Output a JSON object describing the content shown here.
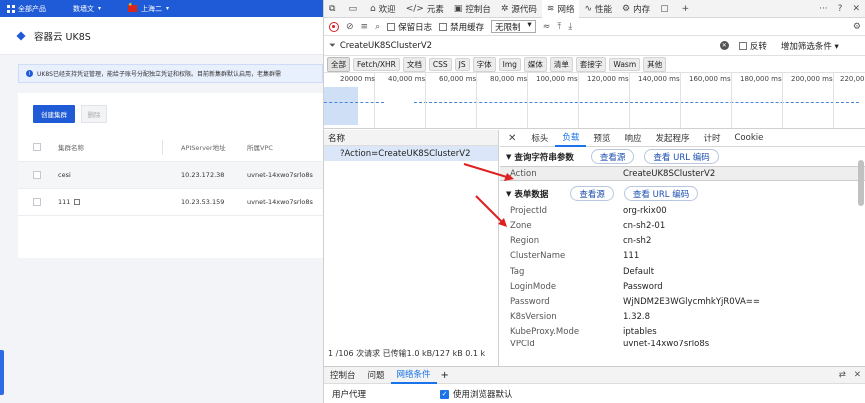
{
  "console": {
    "topnav": {
      "all_products": "全部产品",
      "project": "数墙文",
      "region": "上海二"
    },
    "page_title": "容器云 UK8S",
    "notice": "UK8S已经支持凭证管理，能给子账号分配独立凭证和权限。目前新集群默认启用，老集群需",
    "create_button": "创建集群",
    "delete_button": "删除",
    "table": {
      "headers": [
        "集群名称",
        "APIServer地址",
        "所属VPC"
      ],
      "rows": [
        {
          "name": "cesi",
          "api": "10.23.172.38",
          "vpc": "uvnet-14xwo7srlo8s"
        },
        {
          "name": "111",
          "api": "10.23.53.159",
          "vpc": "uvnet-14xwo7srlo8s"
        }
      ]
    }
  },
  "devtools": {
    "tabs": [
      "欢迎",
      "元素",
      "控制台",
      "源代码",
      "网络",
      "性能",
      "内存"
    ],
    "active_tab": "网络",
    "toolbar": {
      "preserve_log": "保留日志",
      "disable_cache": "禁用缓存",
      "throttle": "无限制"
    },
    "filter": {
      "value": "CreateUK8SClusterV2",
      "invert": "反转",
      "more_filters": "增加筛选条件"
    },
    "type_filters": [
      "全部",
      "Fetch/XHR",
      "文档",
      "CSS",
      "JS",
      "字体",
      "Img",
      "媒体",
      "清单",
      "套接字",
      "Wasm",
      "其他"
    ],
    "timeline_ticks": [
      "20000 ms",
      "40,000 ms",
      "60,000 ms",
      "80,000 ms",
      "100,000 ms",
      "120,000 ms",
      "140,000 ms",
      "160,000 ms",
      "180,000 ms",
      "200,000 ms",
      "220,000"
    ],
    "name_header": "名称",
    "request_name": "?Action=CreateUK8SClusterV2",
    "summary": "1 /106 次请求   已传输1.0 kB/127 kB   0.1 k",
    "detail_tabs": [
      "标头",
      "负载",
      "预览",
      "响应",
      "发起程序",
      "计时",
      "Cookie"
    ],
    "active_detail_tab": "负载",
    "query_section": {
      "title": "查询字符串参数",
      "view_source": "查看源",
      "view_url_encoded": "查看 URL 编码"
    },
    "query_params": [
      {
        "k": "Action",
        "v": "CreateUK8SClusterV2"
      }
    ],
    "form_section": {
      "title": "表单数据",
      "view_source": "查看源",
      "view_url_encoded": "查看 URL 编码"
    },
    "form_params": [
      {
        "k": "ProjectId",
        "v": "org-rkix00"
      },
      {
        "k": "Zone",
        "v": "cn-sh2-01"
      },
      {
        "k": "Region",
        "v": "cn-sh2"
      },
      {
        "k": "ClusterName",
        "v": "111"
      },
      {
        "k": "Tag",
        "v": "Default"
      },
      {
        "k": "LoginMode",
        "v": "Password"
      },
      {
        "k": "Password",
        "v": "WjNDM2E3WGlycmhkYjR0VA=="
      },
      {
        "k": "K8sVersion",
        "v": "1.32.8"
      },
      {
        "k": "KubeProxy.Mode",
        "v": "iptables"
      },
      {
        "k": "VPCId",
        "v": "uvnet-14xwo7srlo8s"
      }
    ],
    "drawer_tabs": [
      "控制台",
      "问题",
      "网络条件"
    ],
    "active_drawer_tab": "网络条件",
    "user_agent_label": "用户代理",
    "user_agent_default": "使用浏览器默认"
  }
}
